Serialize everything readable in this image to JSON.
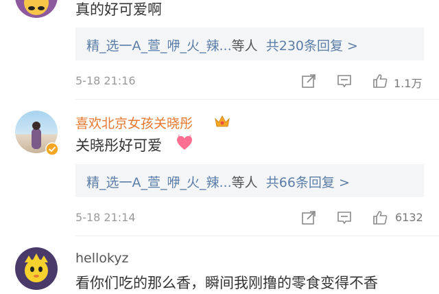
{
  "comments": [
    {
      "text": "真的好可爱啊",
      "reply_users": "精_选一A_萱_咿_火_辣...",
      "reply_suffix": "等人",
      "reply_count": "共230条回复 >",
      "timestamp": "5-18 21:16",
      "likes": "1.1万"
    },
    {
      "username": "喜欢北京女孩关晓彤",
      "text": "关晓彤好可爱",
      "reply_users": "精_选一A_萱_咿_火_辣...",
      "reply_suffix": "等人",
      "reply_count": "共66条回复 >",
      "timestamp": "5-18 21:14",
      "likes": "6132"
    },
    {
      "username": "hellokyz",
      "text": "看你们吃的那么香，瞬间我刚撸的零食变得不香"
    }
  ],
  "colors": {
    "username_vip": "#e8772e",
    "reply_link": "#5a7ea8",
    "verified_badge": "#f5a623"
  }
}
